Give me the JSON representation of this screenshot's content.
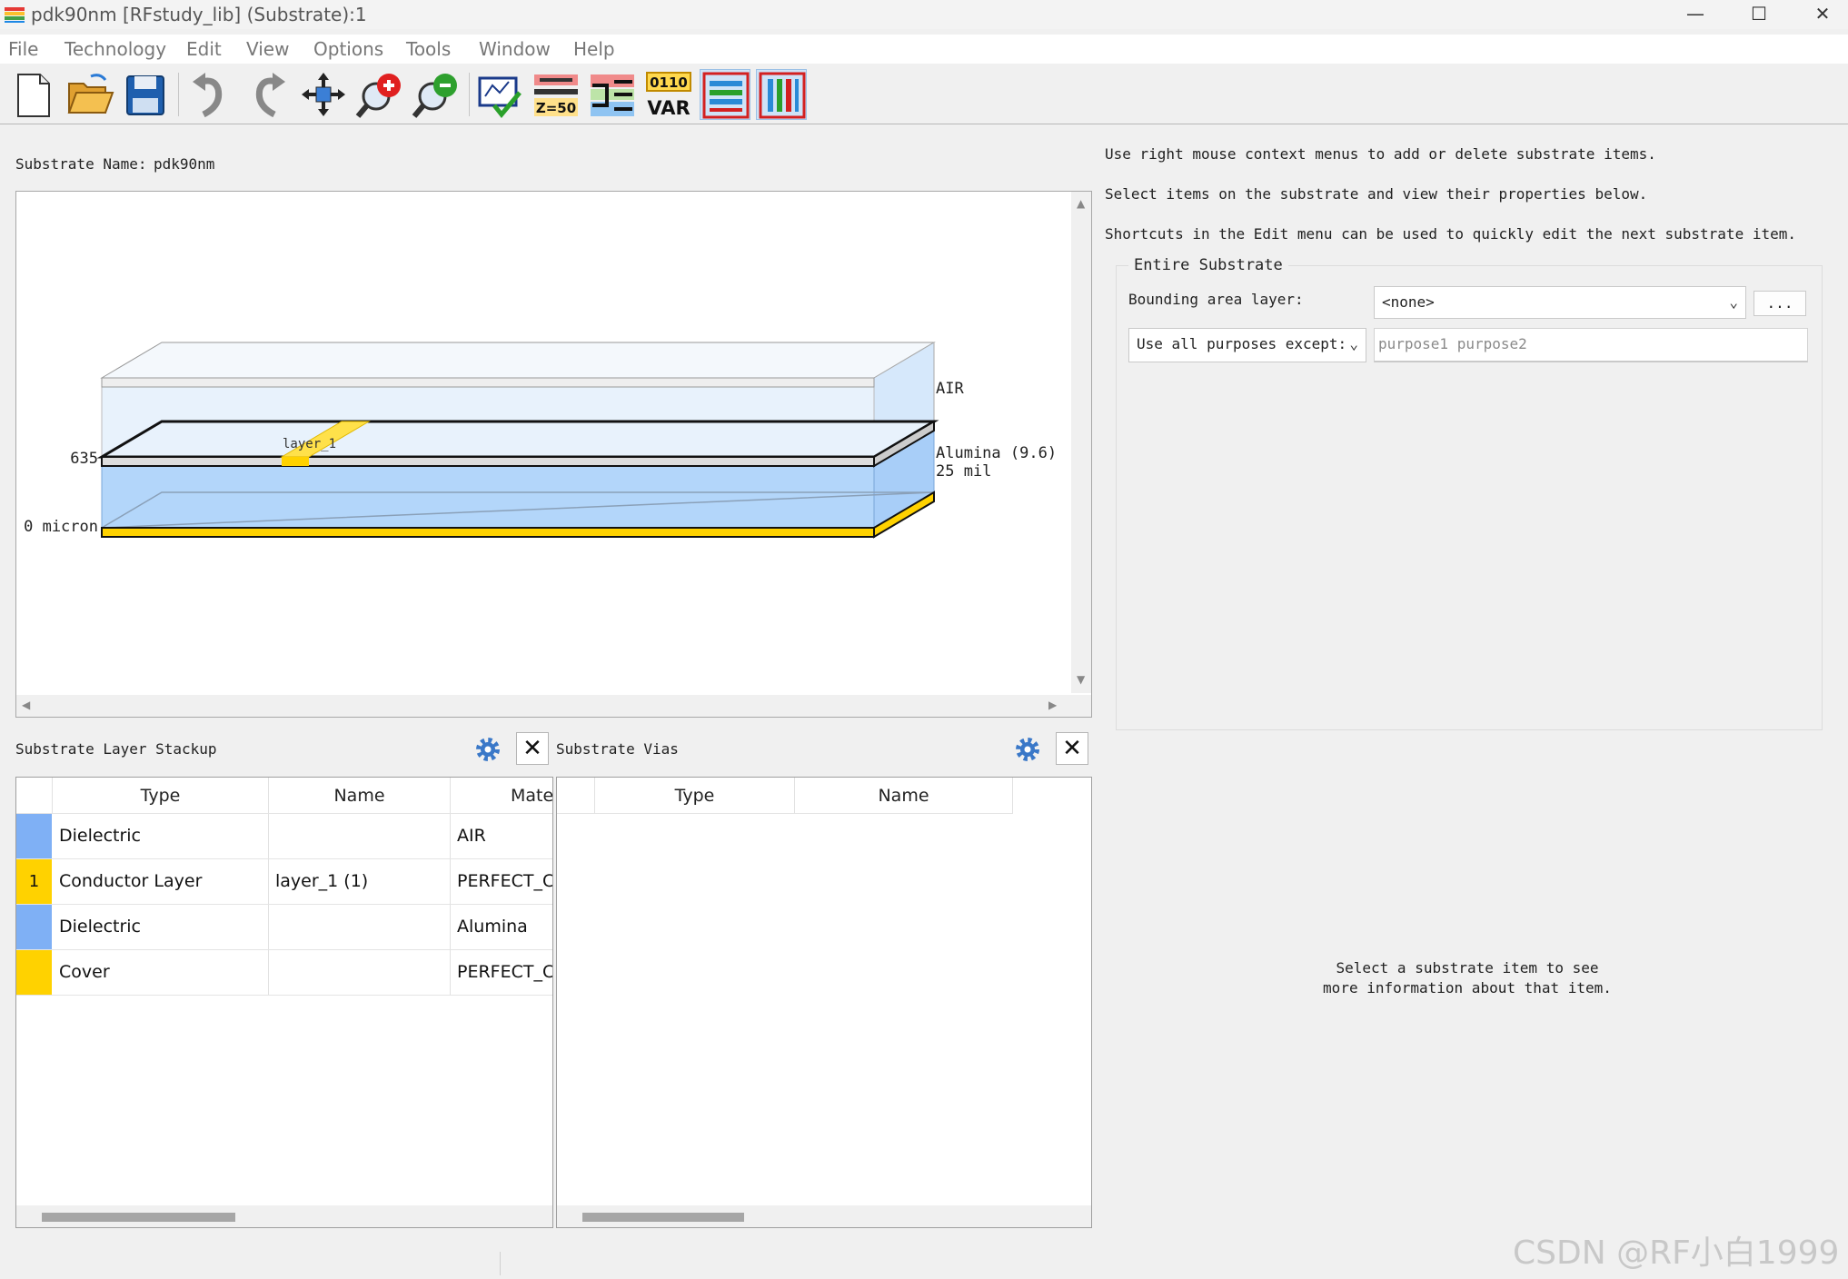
{
  "window": {
    "title": "pdk90nm [RFstudy_lib] (Substrate):1",
    "controls": {
      "minimize": "—",
      "maximize": "☐",
      "close": "✕"
    }
  },
  "menu": [
    "File",
    "Technology",
    "Edit",
    "View",
    "Options",
    "Tools",
    "Window",
    "Help"
  ],
  "toolbar": {
    "icons": [
      "new-icon",
      "open-folder-icon",
      "save-icon",
      "undo-icon",
      "redo-icon",
      "pan-icon",
      "zoom-in-icon",
      "zoom-out-icon",
      "check-icon",
      "z50-icon",
      "tline-icon",
      "var-icon",
      "stack-layers-icon",
      "vertical-layers-icon"
    ],
    "z50_label": "Z=50",
    "var_top": "0110",
    "var_label": "VAR"
  },
  "substrate_name": {
    "label": "Substrate Name:",
    "value": "pdk90nm"
  },
  "canvas": {
    "label_635": "635",
    "label_0": "0 micron",
    "air": "AIR",
    "alumina": "Alumina (9.6)",
    "thickness": "25 mil",
    "strip": "layer_1",
    "colors": {
      "dielectric": "#a8cef8",
      "conductor": "#ffd200",
      "air": "#eaf3fc"
    }
  },
  "info": {
    "line1": "Use right mouse context menus to add or delete substrate items.",
    "line2": "Select items on the substrate and view their properties below.",
    "line3": "Shortcuts in the Edit menu can be used to quickly edit the next substrate item."
  },
  "entire_substrate": {
    "title": "Entire Substrate",
    "bounding_label": "Bounding area layer:",
    "bounding_value": "<none>",
    "ellipsis": "...",
    "purposes_combo": "Use all purposes except:",
    "purposes_placeholder": "purpose1 purpose2"
  },
  "stackup": {
    "title": "Substrate Layer Stackup",
    "headers": [
      "Type",
      "Name",
      "Material"
    ],
    "rows": [
      {
        "idx": "",
        "color": "#7fb0f5",
        "type": "Dielectric",
        "name": "",
        "material": "AIR"
      },
      {
        "idx": "1",
        "color": "#ffd200",
        "type": "Conductor Layer",
        "name": "layer_1 (1)",
        "material": "PERFECT_CONDUCTOR"
      },
      {
        "idx": "",
        "color": "#7fb0f5",
        "type": "Dielectric",
        "name": "",
        "material": "Alumina"
      },
      {
        "idx": "",
        "color": "#ffd200",
        "type": "Cover",
        "name": "",
        "material": "PERFECT_CONDUCTOR"
      }
    ]
  },
  "vias": {
    "title": "Substrate Vias",
    "headers": [
      "Type",
      "Name"
    ]
  },
  "properties_hint": {
    "line1": "Select a substrate item to see",
    "line2": "more information about that item."
  },
  "watermark": "CSDN @RF小白1999"
}
